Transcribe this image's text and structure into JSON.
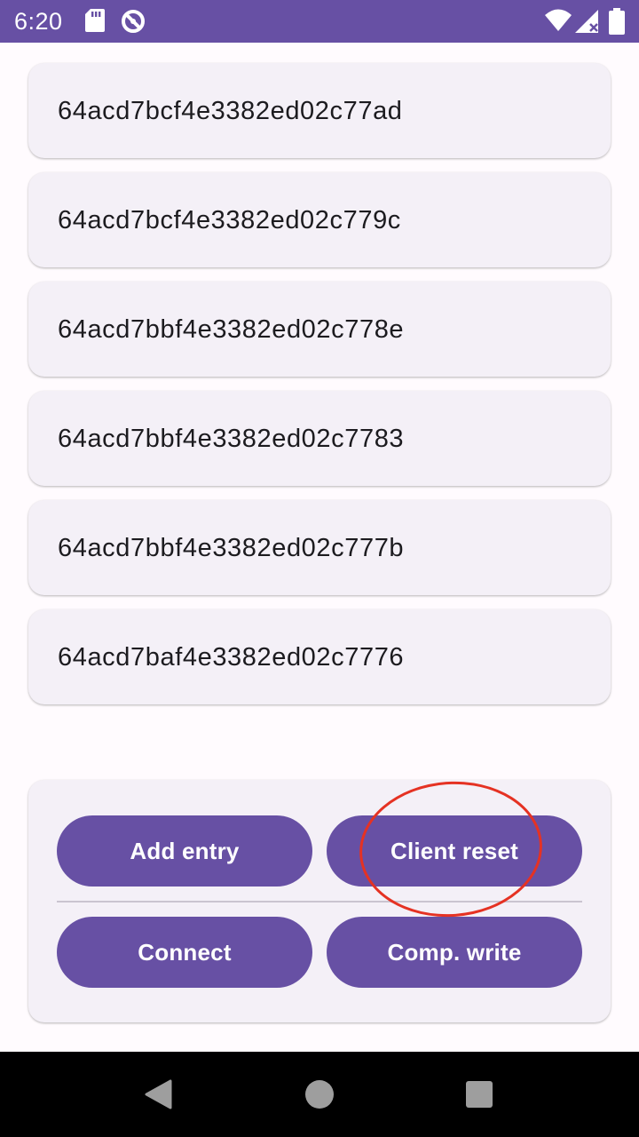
{
  "status_bar": {
    "time": "6:20",
    "icons": [
      "sd-card-icon",
      "sync-icon",
      "wifi-icon",
      "signal-icon",
      "battery-icon"
    ],
    "background": "#6750a4"
  },
  "entries": [
    {
      "id": "64acd7bcf4e3382ed02c77ad"
    },
    {
      "id": "64acd7bcf4e3382ed02c779c"
    },
    {
      "id": "64acd7bbf4e3382ed02c778e"
    },
    {
      "id": "64acd7bbf4e3382ed02c7783"
    },
    {
      "id": "64acd7bbf4e3382ed02c777b"
    },
    {
      "id": "64acd7baf4e3382ed02c7776"
    }
  ],
  "actions": {
    "add_entry": "Add entry",
    "client_reset": "Client reset",
    "connect": "Connect",
    "comp_write": "Comp. write"
  },
  "colors": {
    "accent": "#6750a4",
    "card": "#f4f0f7",
    "annotation": "#e53223"
  },
  "nav_bar": {
    "icons": [
      "back-icon",
      "home-icon",
      "recents-icon"
    ]
  }
}
